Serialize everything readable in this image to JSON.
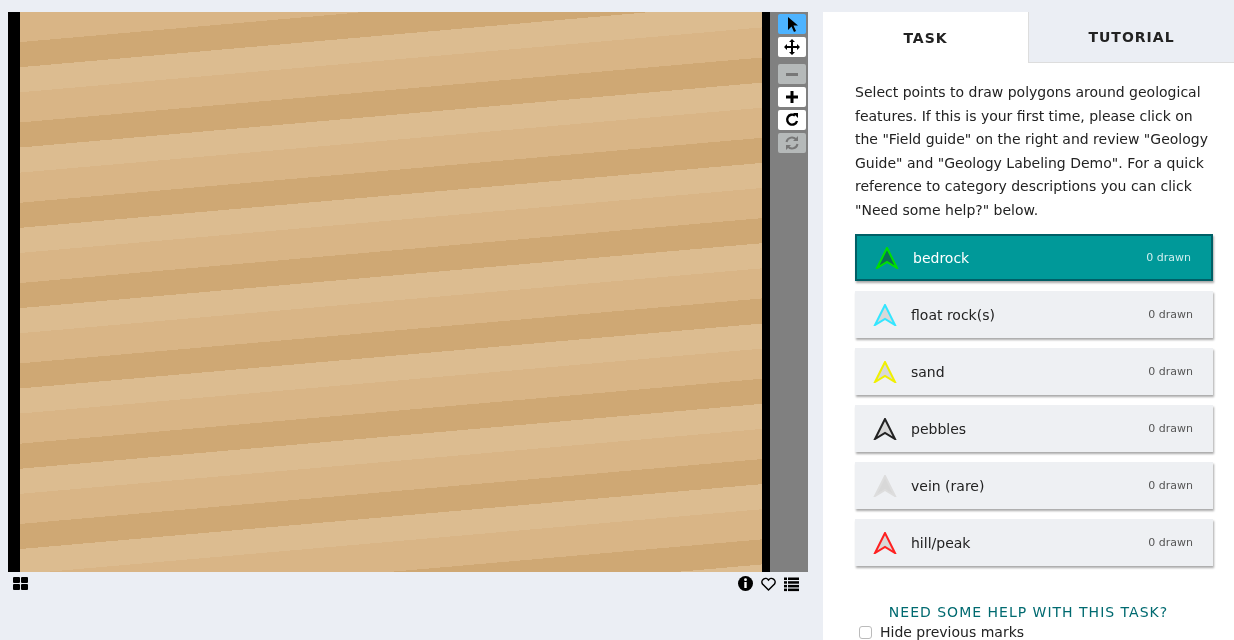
{
  "viewer": {
    "tools": [
      {
        "kind": "pointer",
        "selected": true,
        "disabled": false
      },
      {
        "kind": "move",
        "selected": false,
        "disabled": false
      },
      {
        "kind": "zoom-out",
        "selected": false,
        "disabled": true
      },
      {
        "kind": "zoom-in",
        "selected": false,
        "disabled": false
      },
      {
        "kind": "rotate",
        "selected": false,
        "disabled": false
      },
      {
        "kind": "reset",
        "selected": false,
        "disabled": true
      }
    ],
    "footer_icons": [
      {
        "kind": "grid"
      },
      {
        "kind": "info"
      },
      {
        "kind": "heart"
      },
      {
        "kind": "list"
      }
    ]
  },
  "tabs": [
    {
      "label": "TASK",
      "selected": true
    },
    {
      "label": "TUTORIAL",
      "selected": false
    }
  ],
  "instructions": "Select points to draw polygons around geological features. If this is your first time, please click on the \"Field guide\" on the right and review \"Geology Guide\" and \"Geology Labeling Demo\". For a quick reference to category descriptions you can click \"Need some help?\" below.",
  "tools": [
    {
      "label": "bedrock",
      "count": "0 drawn",
      "color": "#00e000",
      "selected": true
    },
    {
      "label": "float rock(s)",
      "count": "0 drawn",
      "color": "#33e6ff",
      "selected": false
    },
    {
      "label": "sand",
      "count": "0 drawn",
      "color": "#f0f000",
      "selected": false
    },
    {
      "label": "pebbles",
      "count": "0 drawn",
      "color": "#222222",
      "selected": false
    },
    {
      "label": "vein (rare)",
      "count": "0 drawn",
      "color": "#dddddd",
      "selected": false
    },
    {
      "label": "hill/peak",
      "count": "0 drawn",
      "color": "#ff2020",
      "selected": false
    }
  ],
  "help_link": "NEED SOME HELP WITH THIS TASK?",
  "hide_previous_marks": {
    "label": "Hide previous marks",
    "checked": false
  }
}
